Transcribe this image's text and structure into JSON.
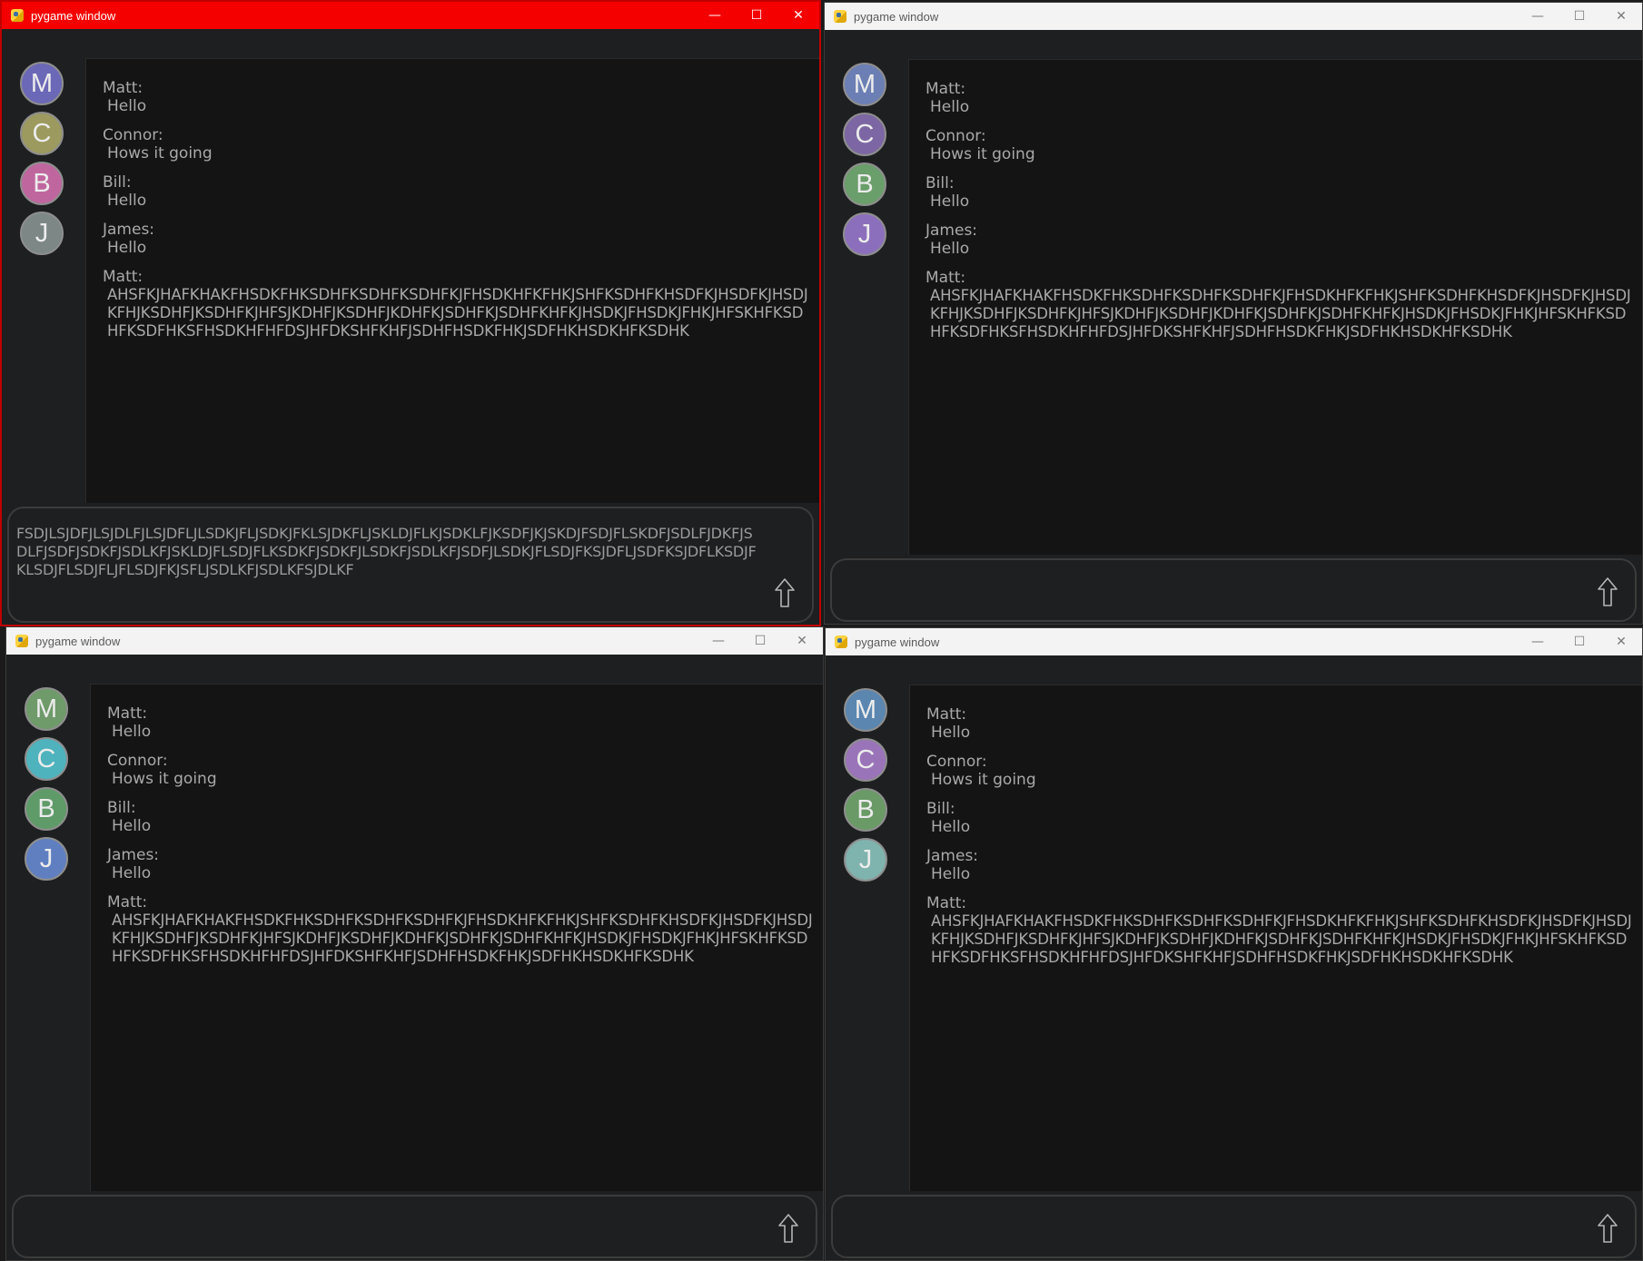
{
  "app": {
    "window_title": "pygame window",
    "controls": {
      "minimize": "—",
      "maximize": "☐",
      "close": "✕"
    }
  },
  "users": {
    "matt": "M",
    "connor": "C",
    "bill": "B",
    "james": "J"
  },
  "messages": [
    {
      "author": "Matt:",
      "text": "Hello"
    },
    {
      "author": "Connor:",
      "text": "Hows it going"
    },
    {
      "author": "Bill:",
      "text": "Hello"
    },
    {
      "author": "James:",
      "text": "Hello"
    },
    {
      "author": "Matt:",
      "text": "AHSFKJHAFKHAKFHSDKFHKSDHFKSDHFKSDHFKJFHSDKHFKFHKJSHFKSDHFKHSDFKJHSDFKJHSDJKFHJKSDHFJKSDHFKJHFSJKDHFJKSDHFJKDHFKJSDHFKJSDHFKHFKJHSDKJFHSDKJFHKJHFSKHFKSDHFKSDFHKSFHSDKHFHFDSJHFDKSHFKHFJSDHFHSDKFHKJSDFHKHSDKHFKSDHK"
    }
  ],
  "windows": [
    {
      "state": "active",
      "avatar_colors": [
        "#6b68b7",
        "#9c9a5e",
        "#c0669f",
        "#7c8786"
      ],
      "input_text": "FSDJLSJDFJLSJDLFJLSJDFLJLSDKJFLJSDKJFKLSJDKFLJSKLDJFLKJSDKLFJKSDFJKJSKDJFSDJFLSKDFJSDLFJDKFJSDLFJSDFJSDKFJSDLKFJSKLDJFLSDJFLKSDKFJSDKFJLSDKFJSDLKFJSDFJLSDKJFLSDJFKSJDFLJSDFKSJDFLKSDJFKLSDJFLSDJFLJFLSDJFKJSFLJSDLKFJSDLKFSJDLKF"
    },
    {
      "state": "inactive",
      "avatar_colors": [
        "#6c7fb5",
        "#7c66a3",
        "#6a9e6a",
        "#8b6fbc"
      ],
      "input_text": ""
    },
    {
      "state": "inactive",
      "avatar_colors": [
        "#6f9a6a",
        "#4fb3bd",
        "#5e9b68",
        "#5f7fc0"
      ],
      "input_text": ""
    },
    {
      "state": "inactive",
      "avatar_colors": [
        "#5a86b0",
        "#9a74b8",
        "#6a9a66",
        "#7fb3ad"
      ],
      "input_text": ""
    }
  ]
}
